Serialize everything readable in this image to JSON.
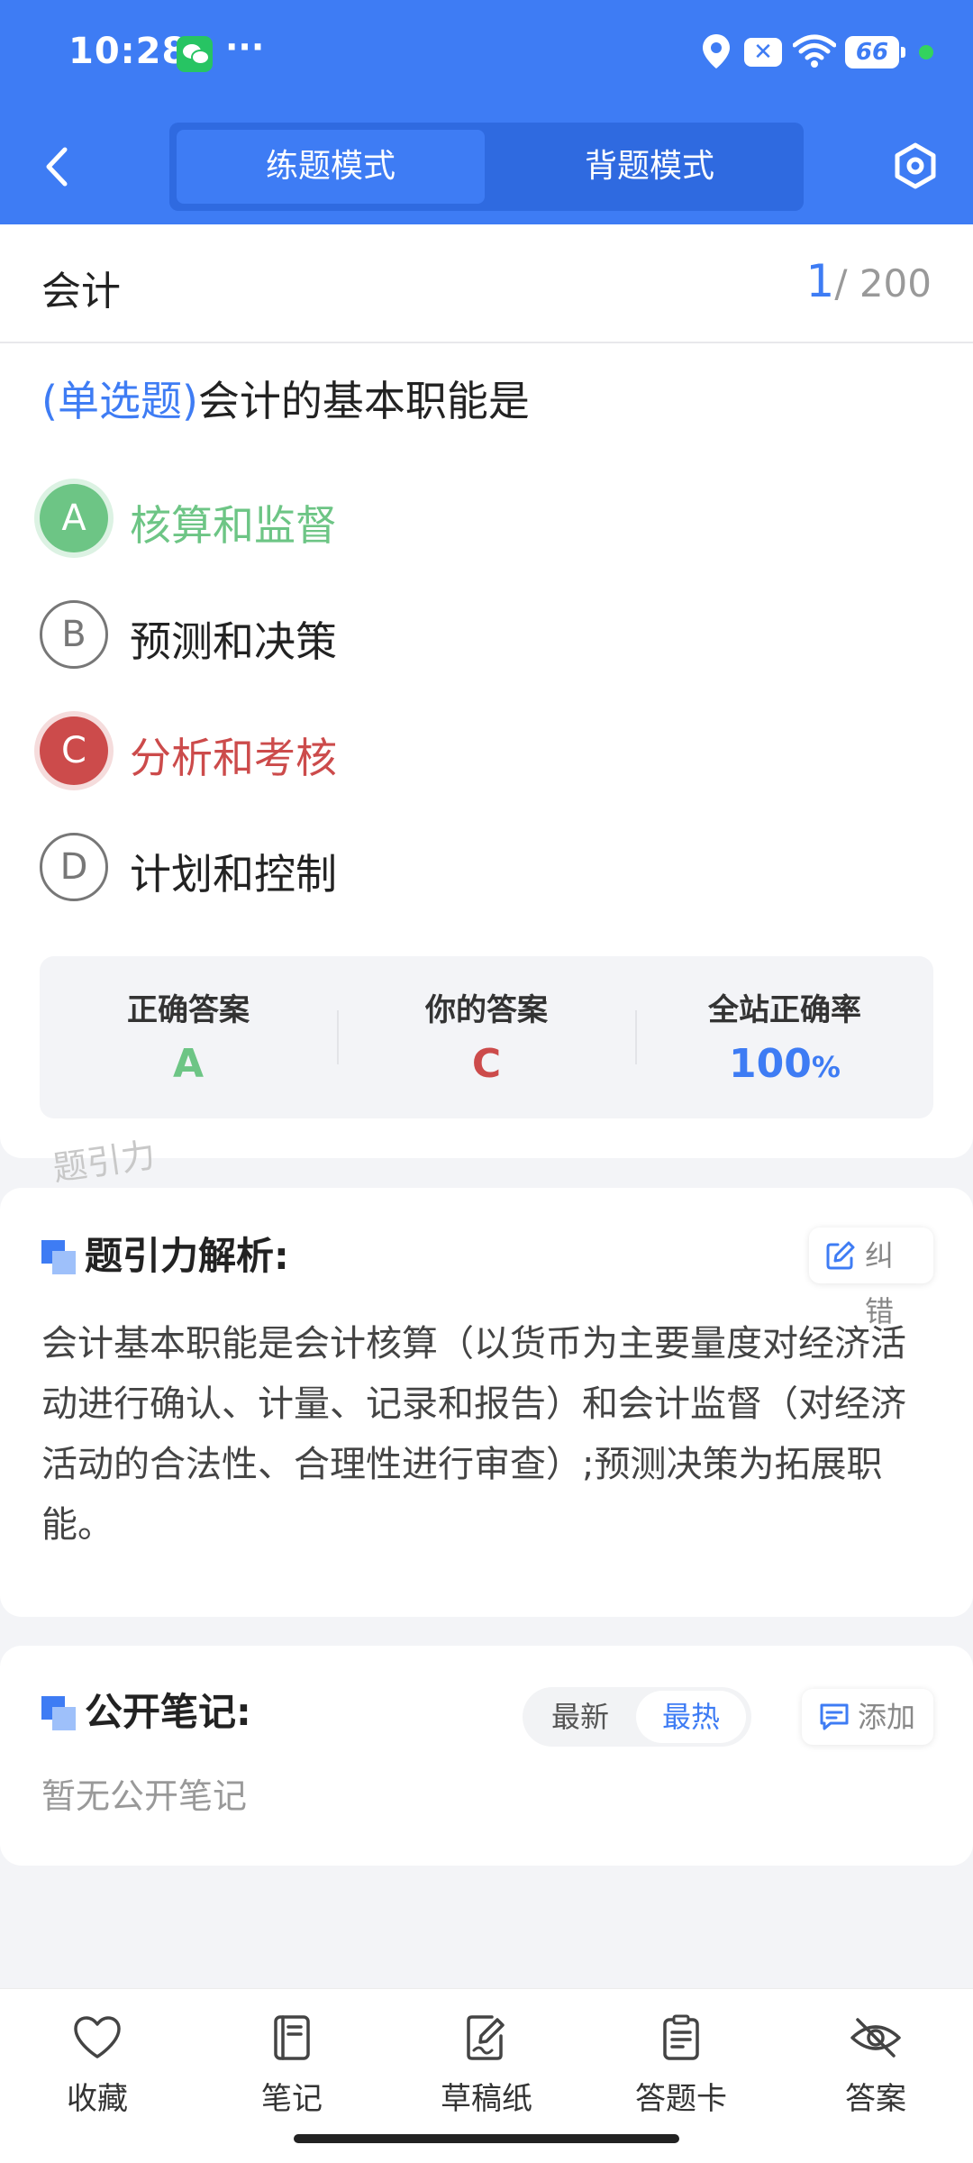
{
  "status": {
    "time": "10:28",
    "more": "···",
    "battery": "66",
    "close_badge": "✕"
  },
  "header": {
    "tabs": [
      {
        "label": "练题模式",
        "active": true
      },
      {
        "label": "背题模式",
        "active": false
      }
    ]
  },
  "question": {
    "subject": "会计",
    "current": "1",
    "total": "/ 200",
    "type": "(单选题)",
    "text": "会计的基本职能是",
    "options": [
      {
        "letter": "A",
        "text": "核算和监督",
        "state": "correct"
      },
      {
        "letter": "B",
        "text": "预测和决策",
        "state": "normal"
      },
      {
        "letter": "C",
        "text": "分析和考核",
        "state": "wrong"
      },
      {
        "letter": "D",
        "text": "计划和控制",
        "state": "normal"
      }
    ]
  },
  "answer_summary": {
    "correct_label": "正确答案",
    "correct_value": "A",
    "yours_label": "你的答案",
    "yours_value": "C",
    "rate_label": "全站正确率",
    "rate_value": "100",
    "rate_unit": "%"
  },
  "watermark": "题引力",
  "analysis": {
    "title": "题引力解析:",
    "correct_button": "纠错",
    "text": "会计基本职能是会计核算（以货币为主要量度对经济活动进行确认、计量、记录和报告）和会计监督（对经济活动的合法性、合理性进行审查）;预测决策为拓展职能。"
  },
  "notes": {
    "title": "公开笔记:",
    "sort_new": "最新",
    "sort_hot": "最热",
    "add_button": "添加",
    "empty_text": "暂无公开笔记"
  },
  "bottom_nav": [
    {
      "label": "收藏",
      "icon": "heart-icon"
    },
    {
      "label": "笔记",
      "icon": "notebook-icon"
    },
    {
      "label": "草稿纸",
      "icon": "draft-paper-icon"
    },
    {
      "label": "答题卡",
      "icon": "answer-sheet-icon"
    },
    {
      "label": "答案",
      "icon": "eye-off-icon"
    }
  ],
  "colors": {
    "brand_blue": "#3e7cf4",
    "correct_green": "#6dc585",
    "wrong_red": "#cc4b4b"
  }
}
